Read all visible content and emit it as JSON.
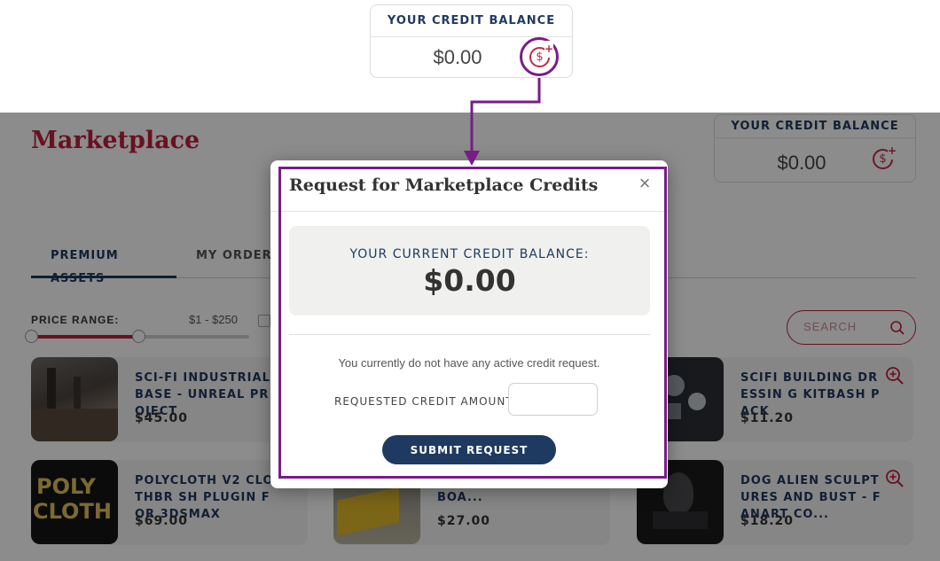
{
  "callout": {
    "title": "YOUR CREDIT BALANCE",
    "amount": "$0.00",
    "icon": "add-credit-coin-icon"
  },
  "page": {
    "title": "Marketplace"
  },
  "credit_card": {
    "title": "YOUR CREDIT BALANCE",
    "amount": "$0.00"
  },
  "tabs": [
    {
      "label": "PREMIUM ASSETS",
      "active": true
    },
    {
      "label": "MY ORDERS",
      "active": false
    }
  ],
  "filters": {
    "price_label": "PRICE RANGE:",
    "price_range": "$1 - $250",
    "search_placeholder": "SEARCH"
  },
  "assets": [
    {
      "title": "SCI-FI INDUSTRIAL BASE - UNREAL PROJECT",
      "price": "$45.00"
    },
    {
      "title": "SCIFI BUILDING DRESSIN G KITBASH PACK",
      "price": "$11.20"
    },
    {
      "title": "POLYCLOTH V2 CLOTHBR SH PLUGIN FOR 3DSMAX",
      "price": "$69.00"
    },
    {
      "title": "ABLE RC JETSPRINT BOA...",
      "price": "$27.00"
    },
    {
      "title": "DOG ALIEN SCULPTURES AND BUST - FANART CO...",
      "price": "$18.20"
    }
  ],
  "thumb_text": {
    "poly": "POLY",
    "cloth": "CLOTH"
  },
  "modal": {
    "title": "Request for Marketplace Credits",
    "close_label": "×",
    "balance_label": "YOUR CURRENT CREDIT BALANCE:",
    "balance_value": "$0.00",
    "status_message": "You currently do not have any active credit request.",
    "amount_label": "REQUESTED CREDIT AMOUNT:",
    "amount_value": "",
    "submit_label": "SUBMIT REQUEST"
  },
  "colors": {
    "brand_red": "#c01e3c",
    "navy": "#1f3a60",
    "highlight_purple": "#7a1b8a"
  }
}
